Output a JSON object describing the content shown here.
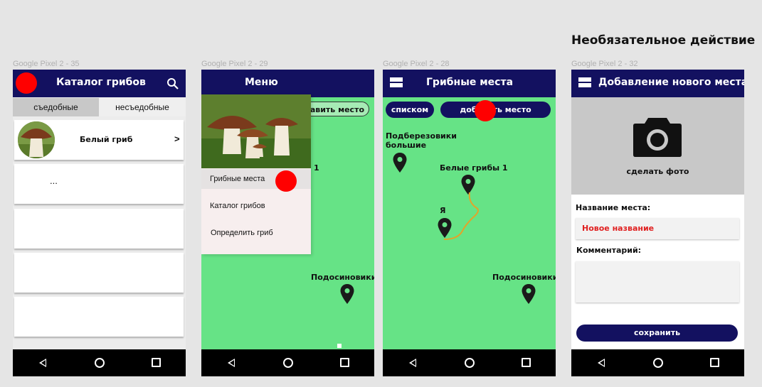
{
  "note": "Необязательное действие",
  "frames": [
    {
      "label": "Google Pixel 2 - 35"
    },
    {
      "label": "Google Pixel 2 - 29"
    },
    {
      "label": "Google Pixel 2 - 28"
    },
    {
      "label": "Google Pixel 2 - 32"
    }
  ],
  "catalog": {
    "title": "Каталог грибов",
    "tabs": [
      "съедобные",
      "несъедобные"
    ],
    "items": [
      {
        "name": "Белый гриб",
        "chevron": ">"
      },
      {
        "name": "..."
      }
    ]
  },
  "menu": {
    "title": "Меню",
    "items": [
      "Грибные места",
      "Каталог грибов",
      "Определить гриб"
    ],
    "behind_button": "добавить место",
    "behind_label": "1"
  },
  "places": {
    "title": "Грибные места",
    "list_button": "списком",
    "add_button": "добавить место",
    "labels": {
      "podberezoviki": "Подберезовики большие",
      "belye": "Белые грибы 1",
      "me": "Я",
      "podosinoviki": "Подосиновики"
    }
  },
  "add_place": {
    "title": "Добавление нового места",
    "photo_label": "сделать фото",
    "name_label": "Название места:",
    "name_value": "Новое название",
    "comment_label": "Комментарий:",
    "save_button": "сохранить"
  },
  "colors": {
    "header": "#131160",
    "map_green": "#66e386",
    "indicator": "#ff0000",
    "route": "#e2a42a"
  }
}
